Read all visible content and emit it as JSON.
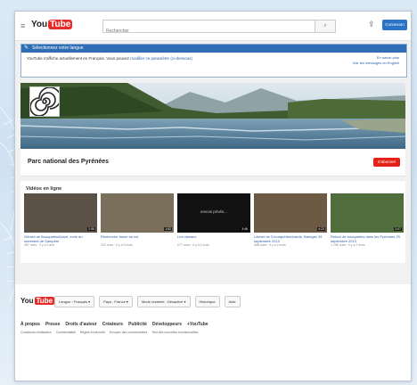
{
  "masthead": {
    "logo_you": "You",
    "logo_tube": "Tube",
    "search_placeholder": "Rechercher",
    "signin_label": "Connexion"
  },
  "language_bar": {
    "title": "Sélectionnez votre langue",
    "message": "YouTube s'affiche actuellement en Français. Vous pouvez",
    "link": "modifier ce paramètre (ci-dessous)",
    "right_line1": "En savoir plus",
    "right_line2": "Voir les messages en English"
  },
  "channel": {
    "name": "Parc national des Pyrénées",
    "subscribe_label": "S'abonner"
  },
  "videos": {
    "section_title": "Vidéos en ligne",
    "items": [
      {
        "title": "Gérard de Bouquetins/Izard, évrié au somment de Sampère",
        "meta": "457 vues · il y a 2 ans",
        "duration": "2:55",
        "color": "#5b5147",
        "overlay": ""
      },
      {
        "title": "Recherche faune au col",
        "meta": "322 vues · il y a 3 mois",
        "duration": "1:52",
        "color": "#7a6f5a",
        "overlay": ""
      },
      {
        "title": "Les oiseaux",
        "meta": "677 vues · il y a 3 mois",
        "duration": "3:46",
        "color": "#111111",
        "overlay": "envois privés..."
      },
      {
        "title": "Lâcher de 3 bouquetins/Izards, Baréges 26 septembre 2013",
        "meta": "688 vues · il y a 2 mois",
        "duration": "4:23",
        "color": "#6c5a45",
        "overlay": ""
      },
      {
        "title": "Retour de bouquetins dans les Pyrénées 25 septembre 2013",
        "meta": "1 106 vues · il y a 2 mois",
        "duration": "2:07",
        "color": "#4f6e3c",
        "overlay": ""
      }
    ]
  },
  "footer": {
    "logo_you": "You",
    "logo_tube": "Tube",
    "buttons": [
      "Langue : Français ▾",
      "Pays : France ▾",
      "Mode restreint : Désactivé ▾",
      "Historique",
      "Aide"
    ],
    "links": [
      "À propos",
      "Presse",
      "Droits d'auteur",
      "Créateurs",
      "Publicité",
      "Développeurs",
      "+YouTube"
    ],
    "sublinks": [
      "Conditions d'utilisation",
      "Confidentialité",
      "Règles et sécurité",
      "Envoyer des commentaires",
      "Test des nouvelles fonctionnalités"
    ]
  }
}
